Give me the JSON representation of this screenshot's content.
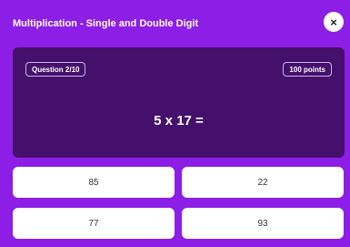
{
  "header": {
    "title": "Multiplication - Single and Double Digit",
    "close_icon": "×"
  },
  "question": {
    "progress": "Question 2/10",
    "points": "100 points",
    "text": "5 x 17 ="
  },
  "answers": [
    "85",
    "22",
    "77",
    "93"
  ],
  "colors": {
    "background": "#8c1ee6",
    "panel": "#45106b",
    "answer_bg": "#ffffff"
  }
}
